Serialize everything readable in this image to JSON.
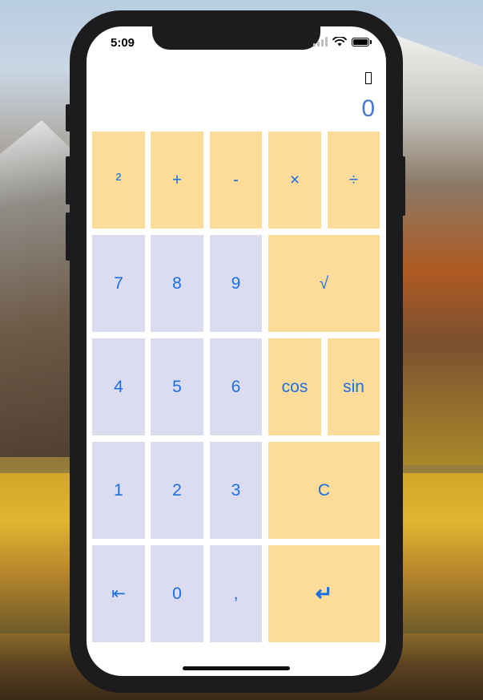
{
  "status_bar": {
    "time": "5:09"
  },
  "display": {
    "value": "0"
  },
  "keys": {
    "square": "²",
    "plus": "+",
    "minus": "-",
    "multiply": "×",
    "divide": "÷",
    "seven": "7",
    "eight": "8",
    "nine": "9",
    "sqrt": "√",
    "four": "4",
    "five": "5",
    "six": "6",
    "cos": "cos",
    "sin": "sin",
    "one": "1",
    "two": "2",
    "three": "3",
    "clear": "C",
    "backspace": "⇤",
    "zero": "0",
    "comma": ",",
    "enter": "↵"
  },
  "colors": {
    "operator_key": "#fddc9a",
    "number_key": "#dcdcf0",
    "key_text": "#1c6fe3",
    "display_text": "#4a77d4"
  }
}
